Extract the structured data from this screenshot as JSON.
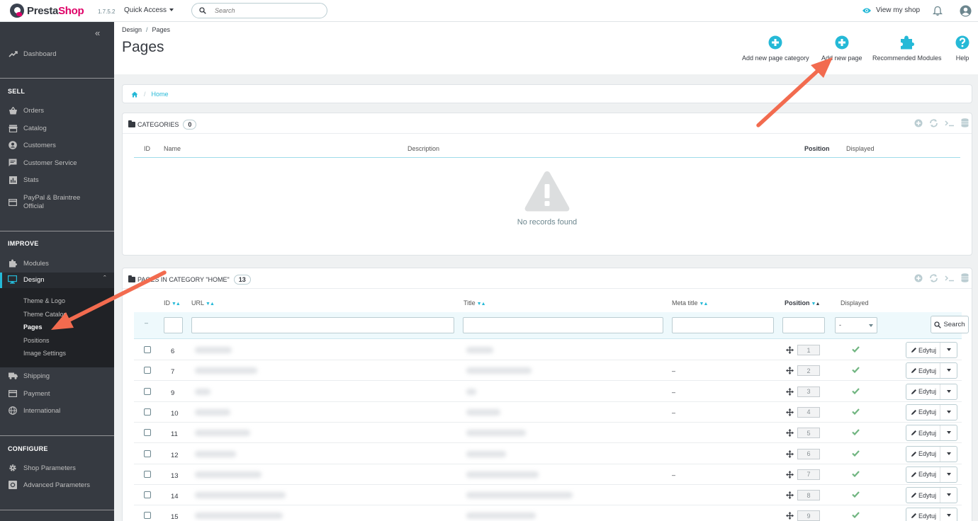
{
  "header": {
    "brand_a": "Presta",
    "brand_b": "Shop",
    "version": "1.7.5.2",
    "quick_access": "Quick Access",
    "search_placeholder": "Search",
    "view_shop": "View my shop"
  },
  "sidebar": {
    "dashboard": "Dashboard",
    "sell_title": "SELL",
    "sell": [
      "Orders",
      "Catalog",
      "Customers",
      "Customer Service",
      "Stats"
    ],
    "paypal_line1": "PayPal & Braintree",
    "paypal_line2": "Official",
    "improve_title": "IMPROVE",
    "modules": "Modules",
    "design": "Design",
    "design_sub": [
      "Theme & Logo",
      "Theme Catalog",
      "Pages",
      "Positions",
      "Image Settings"
    ],
    "improve_rest": [
      "Shipping",
      "Payment",
      "International"
    ],
    "configure_title": "CONFIGURE",
    "configure": [
      "Shop Parameters",
      "Advanced Parameters"
    ]
  },
  "page": {
    "breadcrumb_parent": "Design",
    "breadcrumb_current": "Pages",
    "breadcrumb_sep": "/",
    "title": "Pages",
    "toolbar": {
      "add_category": "Add new page category",
      "add_page": "Add new page",
      "recommended": "Recommended Modules",
      "help": "Help"
    }
  },
  "home_crumb": "Home",
  "categories_panel": {
    "title": "CATEGORIES",
    "count": "0",
    "columns": [
      "ID",
      "Name",
      "Description",
      "Position",
      "Displayed"
    ],
    "empty_text": "No records found"
  },
  "pages_panel": {
    "title": "PAGES IN CATEGORY \"HOME\"",
    "count": "13",
    "columns": [
      "ID",
      "URL",
      "Title",
      "Meta title",
      "Position",
      "Displayed"
    ],
    "select_value": "-",
    "search_button": "Search",
    "rows": [
      {
        "id": "6",
        "meta": "",
        "position": "1",
        "edit": "Edytuj"
      },
      {
        "id": "7",
        "meta": "–",
        "position": "2",
        "edit": "Edytuj"
      },
      {
        "id": "9",
        "meta": "–",
        "position": "3",
        "edit": "Edytuj"
      },
      {
        "id": "10",
        "meta": "–",
        "position": "4",
        "edit": "Edytuj"
      },
      {
        "id": "11",
        "meta": "",
        "position": "5",
        "edit": "Edytuj"
      },
      {
        "id": "12",
        "meta": "",
        "position": "6",
        "edit": "Edytuj"
      },
      {
        "id": "13",
        "meta": "–",
        "position": "7",
        "edit": "Edytuj"
      },
      {
        "id": "14",
        "meta": "",
        "position": "8",
        "edit": "Edytuj"
      },
      {
        "id": "15",
        "meta": "",
        "position": "9",
        "edit": "Edytuj"
      }
    ]
  },
  "colors": {
    "accent": "#25b9d7",
    "sidebar_bg": "#363a41",
    "brand_pink": "#df0067",
    "check_green": "#70b580",
    "arrow": "#f26b4f"
  }
}
